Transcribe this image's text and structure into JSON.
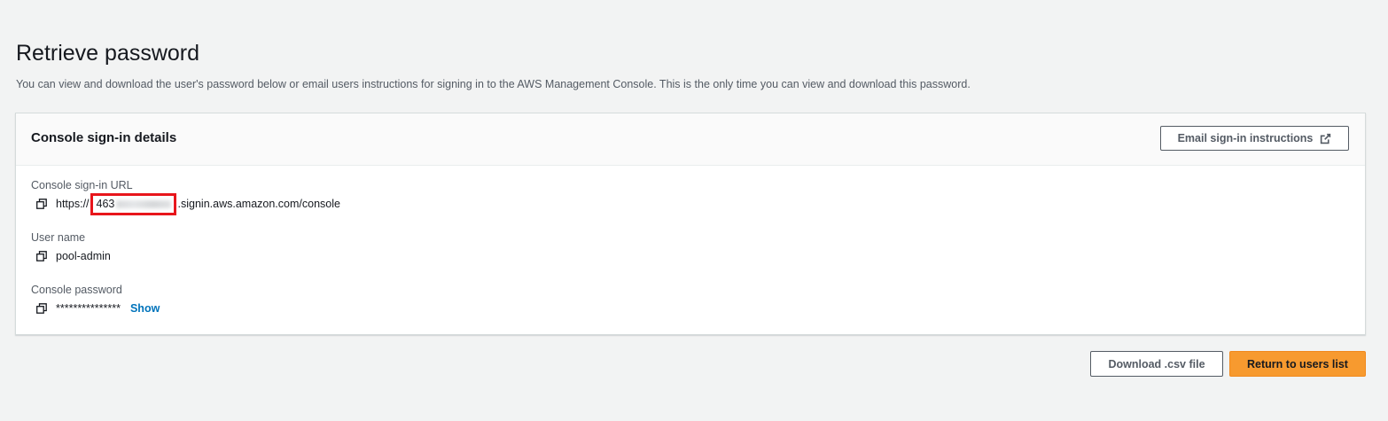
{
  "page": {
    "title": "Retrieve password",
    "description": "You can view and download the user's password below or email users instructions for signing in to the AWS Management Console. This is the only time you can view and download this password."
  },
  "panel": {
    "title": "Console sign-in details",
    "email_button_label": "Email sign-in instructions",
    "fields": {
      "url": {
        "label": "Console sign-in URL",
        "prefix": "https://",
        "account_visible": "463",
        "suffix": ".signin.aws.amazon.com/console"
      },
      "username": {
        "label": "User name",
        "value": "pool-admin"
      },
      "password": {
        "label": "Console password",
        "masked_value": "***************",
        "show_label": "Show"
      }
    }
  },
  "actions": {
    "download_label": "Download .csv file",
    "return_label": "Return to users list"
  },
  "colors": {
    "background": "#f2f3f3",
    "primary_button": "#f79a2f",
    "link": "#0073bb",
    "redaction_box": "#e8151b"
  },
  "icons": {
    "copy": "copy-icon",
    "external": "external-link-icon"
  }
}
